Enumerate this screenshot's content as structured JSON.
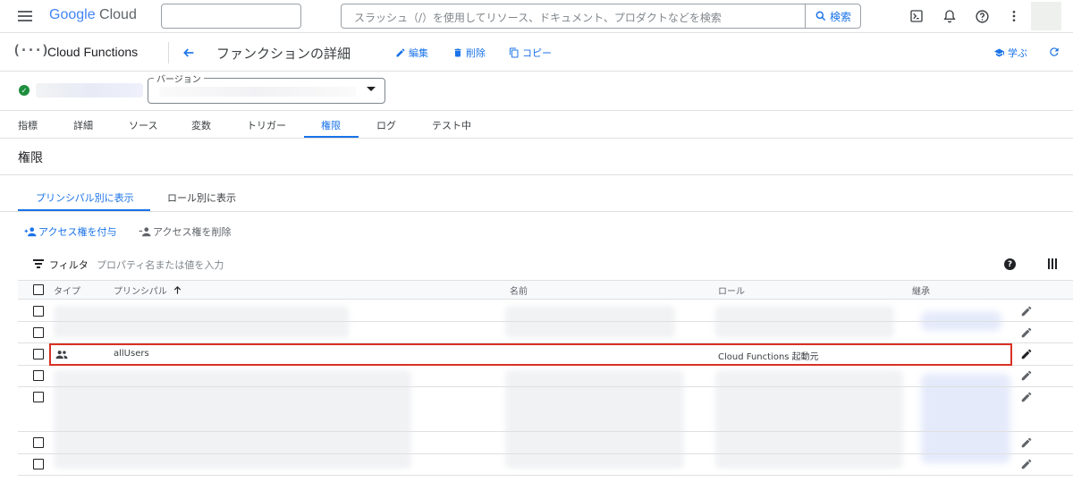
{
  "topbar": {
    "logo_google": "Google",
    "logo_cloud": "Cloud",
    "search_placeholder": "スラッシュ（/）を使用してリソース、ドキュメント、プロダクトなどを検索",
    "search_button": "検索"
  },
  "header": {
    "product": "Cloud Functions",
    "page_title": "ファンクションの詳細",
    "edit": "編集",
    "delete": "削除",
    "copy": "コピー",
    "learn": "学ぶ"
  },
  "version": {
    "label": "バージョン"
  },
  "tabs": [
    {
      "label": "指標"
    },
    {
      "label": "詳細"
    },
    {
      "label": "ソース"
    },
    {
      "label": "変数"
    },
    {
      "label": "トリガー"
    },
    {
      "label": "権限"
    },
    {
      "label": "ログ"
    },
    {
      "label": "テスト中"
    }
  ],
  "section_title": "権限",
  "subtabs": {
    "by_principal": "プリンシパル別に表示",
    "by_role": "ロール別に表示"
  },
  "actions": {
    "grant": "アクセス権を付与",
    "remove": "アクセス権を削除"
  },
  "filter": {
    "label": "フィルタ",
    "placeholder": "プロパティ名または値を入力"
  },
  "table": {
    "columns": {
      "type": "タイプ",
      "principal": "プリンシパル",
      "name": "名前",
      "role": "ロール",
      "inherited": "継承"
    },
    "highlighted_row": {
      "principal": "allUsers",
      "role": "Cloud Functions 起動元"
    }
  },
  "colors": {
    "accent": "#1a73e8",
    "highlight": "#d93025",
    "success": "#1e8e3e"
  }
}
